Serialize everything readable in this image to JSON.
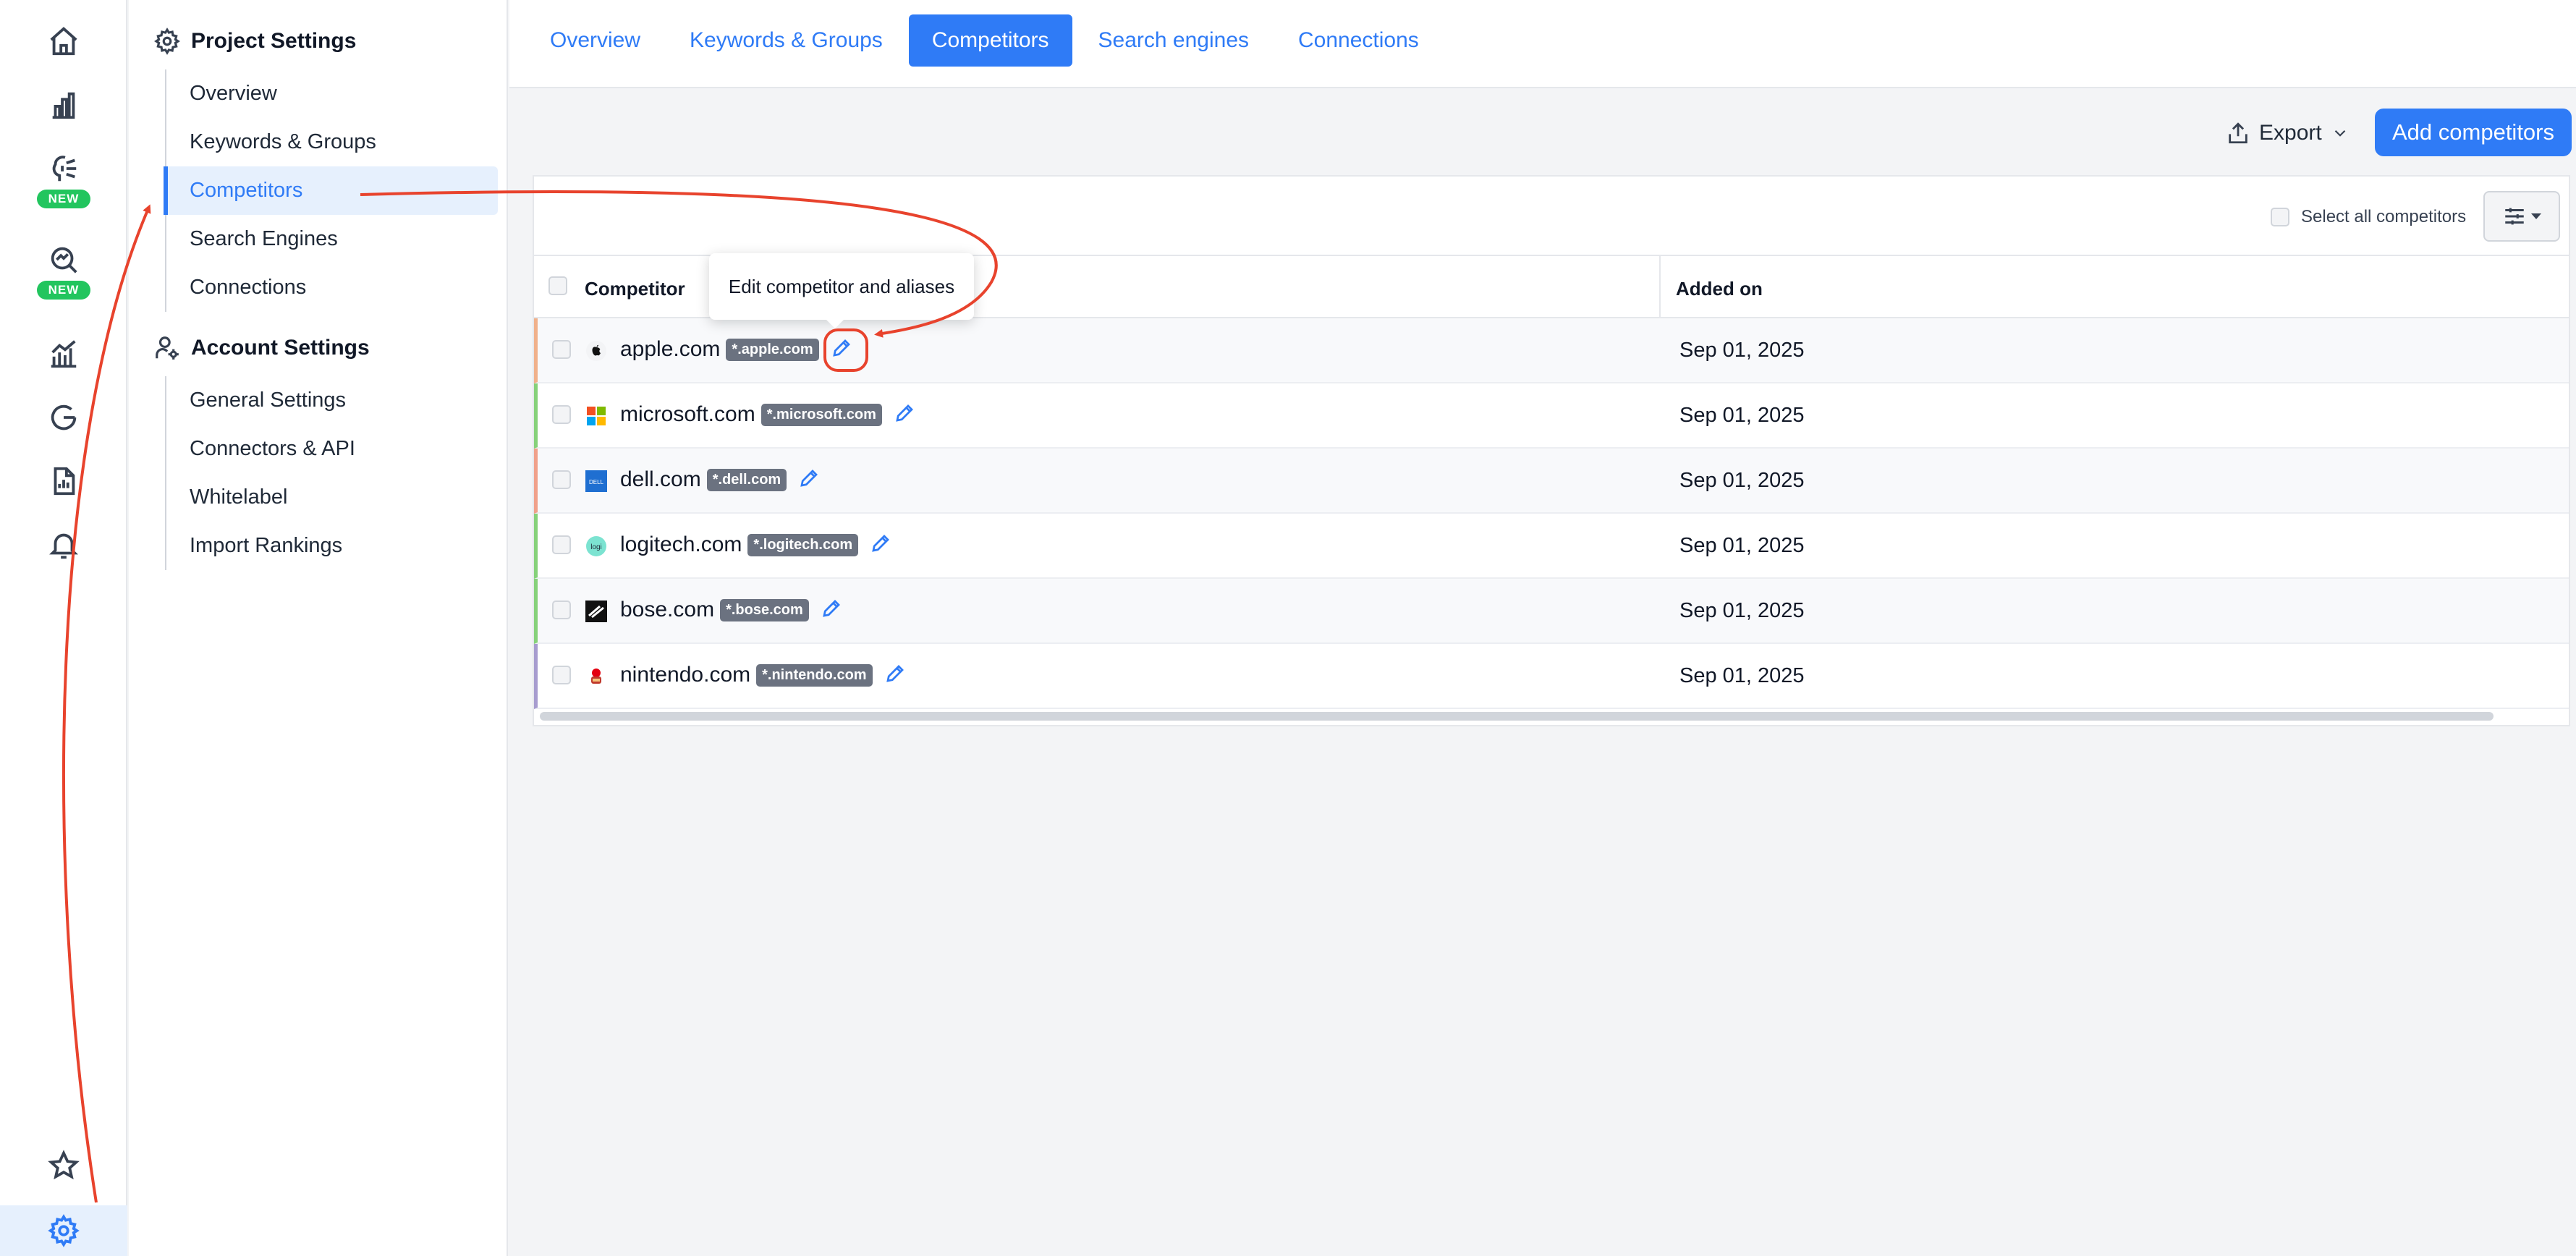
{
  "rail": {
    "items": [
      {
        "name": "home-icon",
        "new": false
      },
      {
        "name": "bar-chart-icon",
        "new": false
      },
      {
        "name": "ai-brain-icon",
        "new": true
      },
      {
        "name": "search-analytics-icon",
        "new": true
      },
      {
        "name": "trend-chart-icon",
        "new": false
      },
      {
        "name": "google-icon",
        "new": false
      },
      {
        "name": "report-icon",
        "new": false
      },
      {
        "name": "bell-icon",
        "new": false
      },
      {
        "name": "star-icon",
        "new": false
      },
      {
        "name": "gear-icon",
        "new": false
      }
    ],
    "new_label": "NEW"
  },
  "sidebar": {
    "project_title": "Project Settings",
    "project_items": [
      "Overview",
      "Keywords & Groups",
      "Competitors",
      "Search Engines",
      "Connections"
    ],
    "active_item": "Competitors",
    "account_title": "Account Settings",
    "account_items": [
      "General Settings",
      "Connectors & API",
      "Whitelabel",
      "Import Rankings"
    ]
  },
  "tabs": {
    "items": [
      "Overview",
      "Keywords & Groups",
      "Competitors",
      "Search engines",
      "Connections"
    ],
    "active": "Competitors"
  },
  "toolbar": {
    "export_label": "Export",
    "add_label": "Add competitors"
  },
  "table": {
    "select_all_label": "Select all competitors",
    "columns": {
      "competitor": "Competitor",
      "added_on": "Added on"
    },
    "rows": [
      {
        "domain": "apple.com",
        "alias": "*.apple.com",
        "added": "Sep 01, 2025",
        "accent": "#f0b08a",
        "favicon": "apple"
      },
      {
        "domain": "microsoft.com",
        "alias": "*.microsoft.com",
        "added": "Sep 01, 2025",
        "accent": "#86d17a",
        "favicon": "microsoft"
      },
      {
        "domain": "dell.com",
        "alias": "*.dell.com",
        "added": "Sep 01, 2025",
        "accent": "#f0a08a",
        "favicon": "dell"
      },
      {
        "domain": "logitech.com",
        "alias": "*.logitech.com",
        "added": "Sep 01, 2025",
        "accent": "#86d17a",
        "favicon": "logitech"
      },
      {
        "domain": "bose.com",
        "alias": "*.bose.com",
        "added": "Sep 01, 2025",
        "accent": "#86d17a",
        "favicon": "bose"
      },
      {
        "domain": "nintendo.com",
        "alias": "*.nintendo.com",
        "added": "Sep 01, 2025",
        "accent": "#a79ccf",
        "favicon": "nintendo"
      }
    ]
  },
  "tooltip": {
    "text": "Edit competitor and aliases"
  },
  "colors": {
    "accent": "#2f7bf6",
    "annotation": "#e8432d",
    "new_badge": "#22c55e"
  }
}
